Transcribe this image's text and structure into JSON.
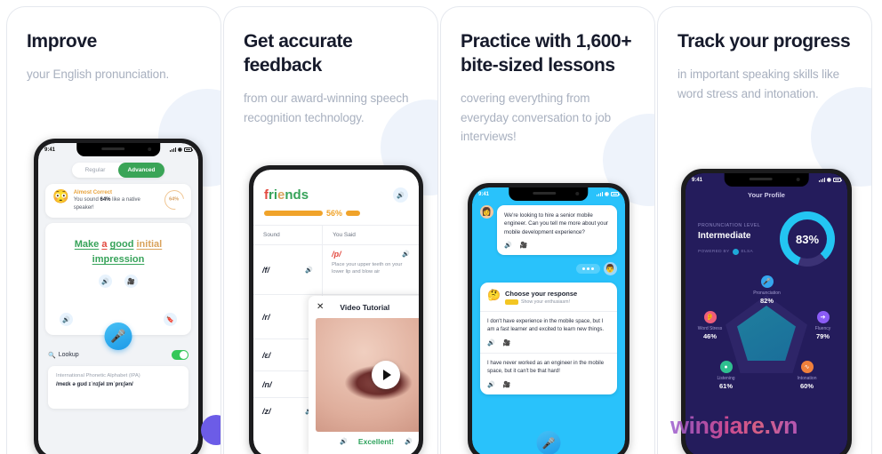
{
  "cards": [
    {
      "title": "Improve",
      "subtitle": "your English pronunciation.",
      "phone": {
        "status_time": "9:41",
        "segment": {
          "left": "Regular",
          "right": "Advanced"
        },
        "feedback": {
          "emoji": "😳",
          "heading": "Almost Correct",
          "body_prefix": "You sound ",
          "body_bold": "64%",
          "body_suffix": " like a native speaker!",
          "score": "64%"
        },
        "sentence": [
          {
            "text": "Make",
            "state": "ok"
          },
          {
            "text": "a",
            "state": "bad"
          },
          {
            "text": "good",
            "state": "ok"
          },
          {
            "text": "initial",
            "state": "mid"
          },
          {
            "text": "impression",
            "state": "ok"
          }
        ],
        "lookup_label": "Lookup",
        "lookup_on": true,
        "ipa_title": "International Phonetic Alphabet (IPA)",
        "ipa_value": "/meɪk ə gʊd ɪˈnɪʃəl ɪmˈprɛʃən/",
        "icons": {
          "speaker": "speaker-icon",
          "video": "video-icon",
          "bookmark": "bookmark-icon",
          "mic": "mic-icon",
          "search": "search-icon"
        }
      }
    },
    {
      "title": "Get accurate feedback",
      "subtitle": "from our award-winning speech recognition technology.",
      "phone": {
        "word": "friends",
        "word_colors": [
          "#e2493f",
          "#37a35a",
          "#37a35a",
          "#d9a25c",
          "#37a35a",
          "#37a35a",
          "#37a35a"
        ],
        "progress": "56%",
        "progress_value": 56,
        "columns": [
          "Sound",
          "You Said"
        ],
        "rows": [
          {
            "sound": "/f/",
            "said": "/p/",
            "said_wrong": true,
            "hint": "Place your upper teeth on your lower lip and blow air"
          },
          {
            "sound": "/r/",
            "said": "",
            "said_wrong": false,
            "hint": ""
          },
          {
            "sound": "/ɛ/",
            "said": "",
            "said_wrong": false,
            "hint": ""
          },
          {
            "sound": "/n/",
            "said": "",
            "said_wrong": false,
            "hint": ""
          },
          {
            "sound": "/z/",
            "said": "",
            "said_wrong": false,
            "hint": ""
          }
        ],
        "result": "Excellent!",
        "video": {
          "close": "✕",
          "title": "Video Tutorial",
          "play": "play-icon"
        }
      }
    },
    {
      "title": "Practice with 1,600+ bite-sized lessons",
      "subtitle": "covering everything from everyday conversation to job interviews!",
      "phone": {
        "status_time": "9:41",
        "interviewer_message": "We're looking to hire a senior mobile engineer. Can you tell me more about your mobile development experience?",
        "interviewer_avatar": "👩",
        "user_avatar": "👨",
        "response_prompt": "Choose your response",
        "response_hint": "Show your enthusiasm!",
        "options": [
          "I don't have experience in the mobile space, but I am a fast learner and excited to learn new things.",
          "I have never worked as an engineer in the mobile space, but it can't be that hard!"
        ],
        "mic": "mic-icon"
      }
    },
    {
      "title": "Track your progress",
      "subtitle": "in important speaking skills like word stress and intonation.",
      "phone": {
        "status_time": "9:41",
        "header": "Your Profile",
        "level_label": "PRONUNCIATION LEVEL",
        "level_value": "Intermediate",
        "powered_by": "POWERED BY",
        "brand": "ELSA",
        "overall_score": "83%",
        "overall_value": 83,
        "skills": [
          {
            "name": "Pronunciation",
            "value": "82%",
            "color": "#35a7ef",
            "icon": "mic-icon"
          },
          {
            "name": "Fluency",
            "value": "79%",
            "color": "#8b5cf6",
            "icon": "flow-icon"
          },
          {
            "name": "Intonation",
            "value": "60%",
            "color": "#f0803c",
            "icon": "wave-icon"
          },
          {
            "name": "Word Stress",
            "value": "46%",
            "color": "#2fbf8f",
            "icon": "stress-icon"
          },
          {
            "name": "Listening",
            "value": "61%",
            "color": "#ef5d7a",
            "icon": "ear-icon"
          }
        ]
      }
    }
  ],
  "watermark": "wingiare.vn"
}
